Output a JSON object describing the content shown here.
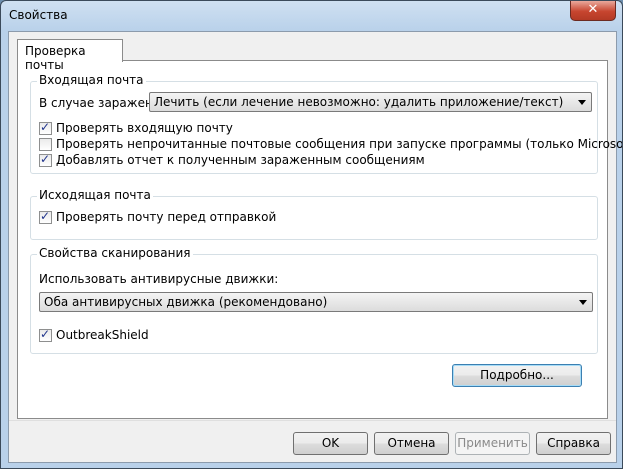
{
  "window": {
    "title": "Свойства",
    "close_symbol": "✕"
  },
  "tab": {
    "label": "Проверка почты"
  },
  "incoming": {
    "title": "Входящая почта",
    "infection_label": "В случае заражения:",
    "infection_value": "Лечить (если лечение невозможно: удалить приложение/текст)",
    "checks": [
      {
        "label": "Проверять входящую почту",
        "checked": true
      },
      {
        "label": "Проверять непрочитанные почтовые сообщения при запуске программы (только Microsoft Outlook)",
        "checked": false
      },
      {
        "label": "Добавлять отчет к полученным зараженным сообщениям",
        "checked": true
      }
    ]
  },
  "outgoing": {
    "title": "Исходящая почта",
    "check": {
      "label": "Проверять почту перед отправкой",
      "checked": true
    }
  },
  "scan": {
    "title": "Свойства сканирования",
    "engines_label": "Использовать антивирусные движки:",
    "engines_value": "Оба антивирусных движка (рекомендовано)",
    "outbreak": {
      "label": "OutbreakShield",
      "checked": true
    }
  },
  "buttons": {
    "details": "Подробно...",
    "ok": "OK",
    "cancel": "Отмена",
    "apply": "Применить",
    "help": "Справка"
  }
}
